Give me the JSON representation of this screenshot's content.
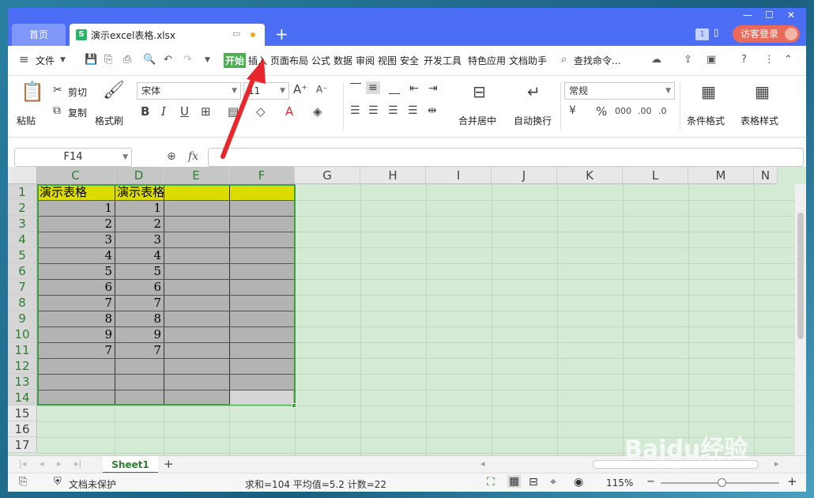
{
  "colors": {
    "titlebar": "#4b6ef5",
    "accent": "#4caf50",
    "selection_fill": "#b3b3b3",
    "header_fill": "#dcdc00",
    "sheet_bg": "#d4ead5",
    "arrow": "#e8262c"
  },
  "tabs": {
    "home": "首页",
    "file": "演示excel表格.xlsx"
  },
  "window": {
    "badge": "1",
    "login": "访客登录"
  },
  "menu": {
    "file": "文件",
    "items": [
      "开始",
      "插入",
      "页面布局",
      "公式",
      "数据",
      "审阅",
      "视图",
      "安全",
      "开发工具",
      "特色应用",
      "文档助手"
    ],
    "search": "查找命令..."
  },
  "ribbon": {
    "paste": "粘贴",
    "cut": "剪切",
    "copy": "复制",
    "format_painter": "格式刷",
    "font_name": "宋体",
    "font_size": "11",
    "merge_center": "合并居中",
    "wrap_text": "自动换行",
    "number_format": "常规",
    "cond_format": "条件格式",
    "table_style": "表格样式",
    "bold": "B",
    "italic": "I",
    "underline": "U"
  },
  "formula_bar": {
    "name_box": "F14",
    "fx": "fx",
    "formula": ""
  },
  "grid": {
    "columns": [
      "C",
      "D",
      "E",
      "F",
      "G",
      "H",
      "I",
      "J",
      "K",
      "L",
      "M",
      "N"
    ],
    "rows": [
      "1",
      "2",
      "3",
      "4",
      "5",
      "6",
      "7",
      "8",
      "9",
      "10",
      "11",
      "12",
      "13",
      "14",
      "15",
      "16",
      "17"
    ],
    "header_cells": [
      "演示表格",
      "演示表格"
    ],
    "col_c_values": [
      "1",
      "2",
      "3",
      "4",
      "5",
      "6",
      "7",
      "8",
      "9",
      "7"
    ],
    "col_d_values": [
      "1",
      "2",
      "3",
      "4",
      "5",
      "6",
      "7",
      "8",
      "9",
      "7"
    ]
  },
  "sheets": {
    "active": "Sheet1",
    "add": "+"
  },
  "status": {
    "protect": "文档未保护",
    "summary": "求和=104  平均值=5.2  计数=22",
    "zoom": "115%"
  },
  "watermark": {
    "brand": "Baidu经验",
    "url": "jingyan.baidu.com"
  }
}
